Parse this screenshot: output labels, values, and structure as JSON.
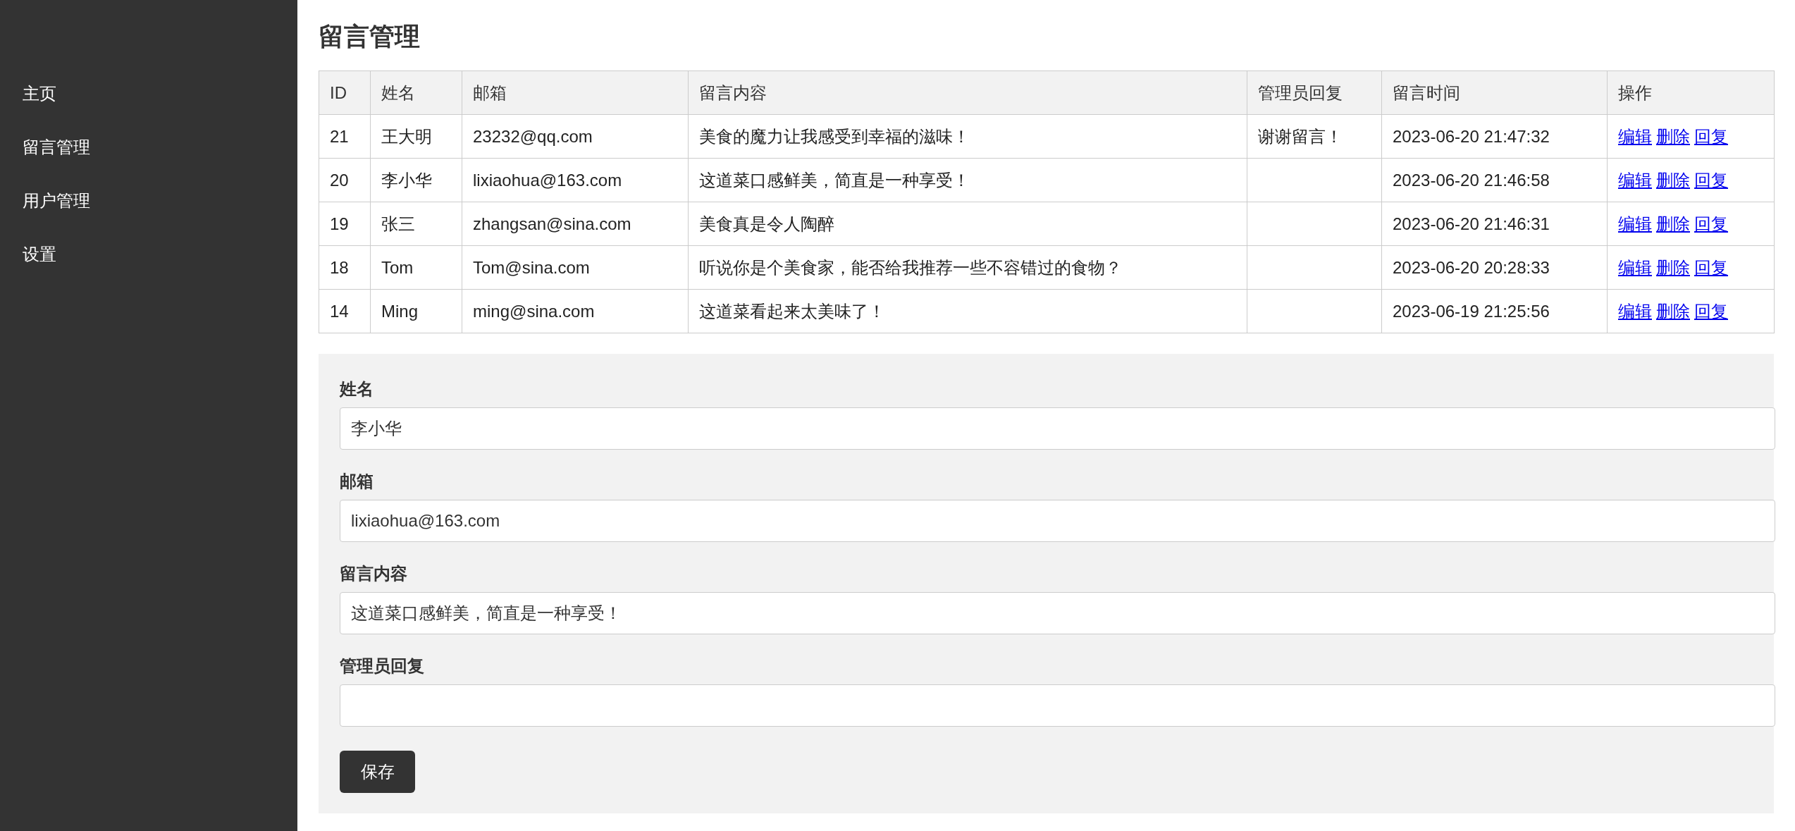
{
  "sidebar": {
    "items": [
      "主页",
      "留言管理",
      "用户管理",
      "设置"
    ]
  },
  "page_title": "留言管理",
  "table": {
    "columns": [
      "ID",
      "姓名",
      "邮箱",
      "留言内容",
      "管理员回复",
      "留言时间",
      "操作"
    ],
    "rows": [
      {
        "id": "21",
        "name": "王大明",
        "email": "23232@qq.com",
        "message": "美食的魔力让我感受到幸福的滋味！",
        "reply": "谢谢留言！",
        "time": "2023-06-20 21:47:32",
        "actions": [
          "编辑",
          "删除",
          "回复"
        ]
      },
      {
        "id": "20",
        "name": "李小华",
        "email": "lixiaohua@163.com",
        "message": "这道菜口感鲜美，简直是一种享受！",
        "reply": "",
        "time": "2023-06-20 21:46:58",
        "actions": [
          "编辑",
          "删除",
          "回复"
        ]
      },
      {
        "id": "19",
        "name": "张三",
        "email": "zhangsan@sina.com",
        "message": "美食真是令人陶醉",
        "reply": "",
        "time": "2023-06-20 21:46:31",
        "actions": [
          "编辑",
          "删除",
          "回复"
        ]
      },
      {
        "id": "18",
        "name": "Tom",
        "email": "Tom@sina.com",
        "message": "听说你是个美食家，能否给我推荐一些不容错过的食物？",
        "reply": "",
        "time": "2023-06-20 20:28:33",
        "actions": [
          "编辑",
          "删除",
          "回复"
        ]
      },
      {
        "id": "14",
        "name": "Ming",
        "email": "ming@sina.com",
        "message": "这道菜看起来太美味了！",
        "reply": "",
        "time": "2023-06-19 21:25:56",
        "actions": [
          "编辑",
          "删除",
          "回复"
        ]
      }
    ]
  },
  "form": {
    "fields": [
      {
        "label": "姓名",
        "value": "李小华"
      },
      {
        "label": "邮箱",
        "value": "lixiaohua@163.com"
      },
      {
        "label": "留言内容",
        "value": "这道菜口感鲜美，简直是一种享受！"
      },
      {
        "label": "管理员回复"
      }
    ],
    "save_button": "保存"
  }
}
